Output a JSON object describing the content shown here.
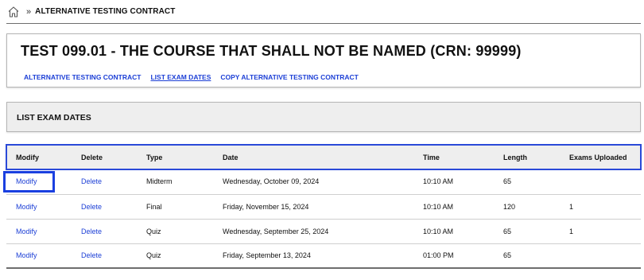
{
  "breadcrumb": {
    "separator": "»",
    "current": "ALTERNATIVE TESTING CONTRACT"
  },
  "course": {
    "title": "TEST 099.01 - THE COURSE THAT SHALL NOT BE NAMED (CRN: 99999)",
    "links": [
      {
        "label": "ALTERNATIVE TESTING CONTRACT",
        "active": false
      },
      {
        "label": "LIST EXAM DATES",
        "active": true
      },
      {
        "label": "COPY ALTERNATIVE TESTING CONTRACT",
        "active": false
      }
    ]
  },
  "exam_section": {
    "title": "LIST EXAM DATES"
  },
  "table": {
    "headers": [
      "Modify",
      "Delete",
      "Type",
      "Date",
      "Time",
      "Length",
      "Exams Uploaded"
    ],
    "rows": [
      {
        "modify": "Modify",
        "delete": "Delete",
        "type": "Midterm",
        "date": "Wednesday, October 09, 2024",
        "time": "10:10 AM",
        "length": "65",
        "uploaded": ""
      },
      {
        "modify": "Modify",
        "delete": "Delete",
        "type": "Final",
        "date": "Friday, November 15, 2024",
        "time": "10:10 AM",
        "length": "120",
        "uploaded": "1"
      },
      {
        "modify": "Modify",
        "delete": "Delete",
        "type": "Quiz",
        "date": "Wednesday, September 25, 2024",
        "time": "10:10 AM",
        "length": "65",
        "uploaded": "1"
      },
      {
        "modify": "Modify",
        "delete": "Delete",
        "type": "Quiz",
        "date": "Friday, September 13, 2024",
        "time": "01:00 PM",
        "length": "65",
        "uploaded": ""
      }
    ]
  },
  "colors": {
    "link": "#1c3fd6",
    "focus_outline": "#1a3fe0",
    "panel_bg": "#eeeeee"
  }
}
